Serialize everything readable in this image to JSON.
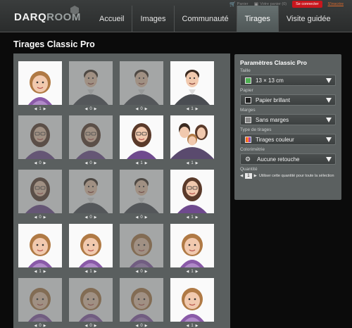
{
  "header": {
    "logo_part1": "DARQ",
    "logo_part2": "ROOM",
    "topbar": {
      "cart_label": "Panier",
      "saved_label": "Votre panier (0)",
      "connect_label": "Se connecter",
      "register_label": "S'inscrire"
    },
    "nav": [
      {
        "label": "Accueil",
        "active": false
      },
      {
        "label": "Images",
        "active": false
      },
      {
        "label": "Communauté",
        "active": false
      },
      {
        "label": "Tirages",
        "active": true
      },
      {
        "label": "Visite guidée",
        "active": false
      }
    ]
  },
  "page_title": "Tirages Classic Pro",
  "grid": {
    "cells": [
      {
        "qty": "1",
        "dim": false,
        "photo": "girl"
      },
      {
        "qty": "0",
        "dim": true,
        "photo": "man"
      },
      {
        "qty": "0",
        "dim": true,
        "photo": "man"
      },
      {
        "qty": "1",
        "dim": false,
        "photo": "man"
      },
      {
        "qty": "0",
        "dim": true,
        "photo": "woman"
      },
      {
        "qty": "0",
        "dim": true,
        "photo": "woman"
      },
      {
        "qty": "1",
        "dim": false,
        "photo": "woman"
      },
      {
        "qty": "1",
        "dim": false,
        "photo": "family"
      },
      {
        "qty": "0",
        "dim": true,
        "photo": "woman"
      },
      {
        "qty": "0",
        "dim": true,
        "photo": "man"
      },
      {
        "qty": "0",
        "dim": true,
        "photo": "man"
      },
      {
        "qty": "1",
        "dim": false,
        "photo": "woman"
      },
      {
        "qty": "1",
        "dim": false,
        "photo": "girl"
      },
      {
        "qty": "1",
        "dim": false,
        "photo": "girl"
      },
      {
        "qty": "0",
        "dim": true,
        "photo": "girl"
      },
      {
        "qty": "1",
        "dim": false,
        "photo": "girl"
      },
      {
        "qty": "0",
        "dim": true,
        "photo": "girl"
      },
      {
        "qty": "0",
        "dim": true,
        "photo": "girl"
      },
      {
        "qty": "0",
        "dim": true,
        "photo": "girl"
      },
      {
        "qty": "1",
        "dim": false,
        "photo": "girl"
      }
    ]
  },
  "settings": {
    "title": "Paramètres Classic Pro",
    "fields": [
      {
        "label": "Taille",
        "value": "13 × 13 cm",
        "icon": "size-icon",
        "color": "#4caf50"
      },
      {
        "label": "Papier",
        "value": "Papier brillant",
        "icon": "paper-icon",
        "color": "#222222"
      },
      {
        "label": "Marges",
        "value": "Sans marges",
        "icon": "margin-icon",
        "color": "#888888"
      },
      {
        "label": "Type de tirages",
        "value": "Tirages couleur",
        "icon": "color-print-icon",
        "color": "#e040a0"
      },
      {
        "label": "Colorimétrie",
        "value": "Aucune retouche",
        "icon": "gear-icon",
        "color": "#cccccc"
      }
    ],
    "quantity": {
      "label": "Quantité",
      "value": "1",
      "apply_text": "Utiliser cette quantité pour toute la sélection"
    }
  }
}
